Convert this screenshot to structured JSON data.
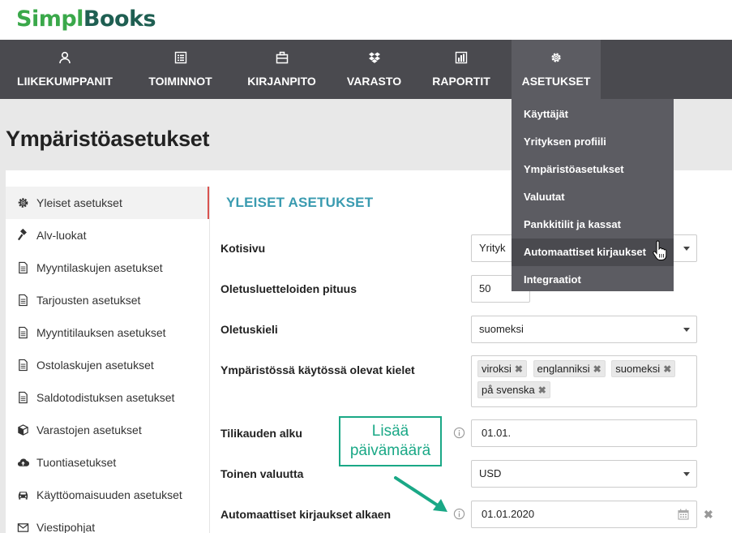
{
  "logo": {
    "simpl": "Simpl",
    "books": "Books"
  },
  "nav": [
    {
      "label": "LIIKEKUMPPANIT",
      "icon": "user-icon"
    },
    {
      "label": "TOIMINNOT",
      "icon": "list-icon"
    },
    {
      "label": "KIRJANPITO",
      "icon": "briefcase-icon"
    },
    {
      "label": "VARASTO",
      "icon": "dropbox-icon"
    },
    {
      "label": "RAPORTIT",
      "icon": "bar-chart-icon"
    },
    {
      "label": "ASETUKSET",
      "icon": "gear-icon"
    }
  ],
  "dropdown": [
    "Käyttäjät",
    "Yrityksen profiili",
    "Ympäristöasetukset",
    "Valuutat",
    "Pankkitilit ja kassat",
    "Automaattiset kirjaukset",
    "Integraatiot"
  ],
  "page_title": "Ympäristöasetukset",
  "sidebar": [
    {
      "label": "Yleiset asetukset",
      "icon": "gear-icon"
    },
    {
      "label": "Alv-luokat",
      "icon": "gavel-icon"
    },
    {
      "label": "Myyntilaskujen asetukset",
      "icon": "document-icon"
    },
    {
      "label": "Tarjousten asetukset",
      "icon": "document-icon"
    },
    {
      "label": "Myyntitilauksen asetukset",
      "icon": "document-icon"
    },
    {
      "label": "Ostolaskujen asetukset",
      "icon": "document-icon"
    },
    {
      "label": "Saldotodistuksen asetukset",
      "icon": "document-icon"
    },
    {
      "label": "Varastojen asetukset",
      "icon": "cube-icon"
    },
    {
      "label": "Tuontiasetukset",
      "icon": "cloud-upload-icon"
    },
    {
      "label": "Käyttöomaisuuden asetukset",
      "icon": "car-icon"
    },
    {
      "label": "Viestipohjat",
      "icon": "envelope-icon"
    }
  ],
  "section_title": "YLEISET ASETUKSET",
  "form": {
    "kotisivu": {
      "label": "Kotisivu",
      "value": "Yrityk"
    },
    "pituus": {
      "label": "Oletusluetteloiden pituus",
      "value": "50"
    },
    "kieli": {
      "label": "Oletuskieli",
      "value": "suomeksi"
    },
    "kielet": {
      "label": "Ympäristössä käytössä olevat kielet",
      "tags": [
        "viroksi",
        "englanniksi",
        "suomeksi",
        "på svenska"
      ],
      "remove": "✖"
    },
    "tilikausi": {
      "label": "Tilikauden alku",
      "value": "01.01."
    },
    "valuutta": {
      "label": "Toinen valuutta",
      "value": "USD"
    },
    "auto": {
      "label": "Automaattiset kirjaukset alkaen",
      "value": "01.01.2020",
      "clear": "✖"
    }
  },
  "callout": {
    "line1": "Lisää",
    "line2": "päivämäärä"
  },
  "colors": {
    "nav_bg": "#4a4a4f",
    "accent": "#3a9bb0",
    "callout": "#1aa886",
    "active_bar": "#d9534f"
  }
}
